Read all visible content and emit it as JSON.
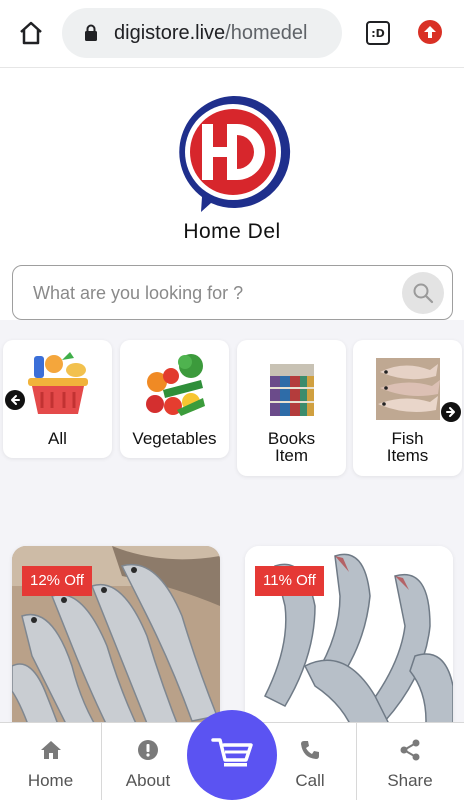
{
  "browser": {
    "url_host": "digistore.live",
    "url_path": "/homedel",
    "tab_label": ":D"
  },
  "brand": {
    "logo_letters": "HD",
    "name": "Home Del"
  },
  "search": {
    "placeholder": "What are you looking for ?"
  },
  "categories": [
    {
      "line1": "All",
      "line2": "",
      "icon": "grocery-basket-icon"
    },
    {
      "line1": "Vegetables",
      "line2": "",
      "icon": "vegetables-icon"
    },
    {
      "line1": "Books",
      "line2": "Item",
      "icon": "books-icon"
    },
    {
      "line1": "Fish",
      "line2": "Items",
      "icon": "fish-icon"
    }
  ],
  "products": [
    {
      "discount": "12% Off"
    },
    {
      "discount": "11% Off"
    }
  ],
  "bottom_nav": {
    "home": "Home",
    "about": "About",
    "call": "Call",
    "share": "Share"
  },
  "colors": {
    "accent": "#5b53f2",
    "badge": "#e53935",
    "logo_red": "#d7262c",
    "logo_blue": "#1f2f8c"
  }
}
